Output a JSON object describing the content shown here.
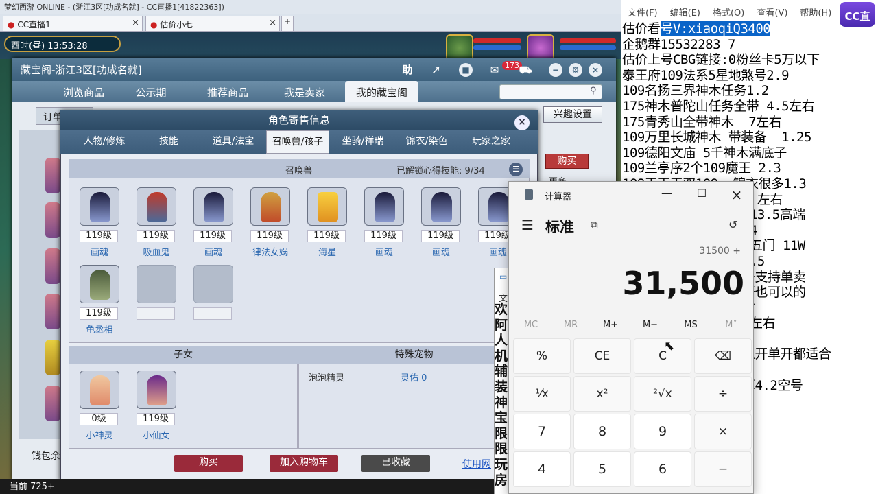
{
  "browser": {
    "title_text": "梦幻西游 ONLINE - (浙江3区[功成名就] - CC直播1[41822363])",
    "tabs": [
      {
        "label": "CC直播1"
      },
      {
        "label": "估价小七"
      }
    ],
    "new_tab_label": "+"
  },
  "game": {
    "clock": "酉时(昼)   13:53:28",
    "bottom_bar": "当前   725+"
  },
  "zbg": {
    "title": "藏宝阁-浙江3区[功成名就]",
    "header_icons": {
      "help": "助",
      "badge": "173"
    },
    "nav": [
      {
        "label": "浏览商品"
      },
      {
        "label": "公示期"
      },
      {
        "label": "推荐商品"
      },
      {
        "label": "我是卖家"
      },
      {
        "label": "我的藏宝阁"
      }
    ],
    "order_tab": "订单",
    "interest_btn": "兴趣设置",
    "buy_btn": "购买",
    "more": "更多",
    "wallet": "钱包余"
  },
  "dialog": {
    "title": "角色寄售信息",
    "tabs": [
      {
        "label": "人物/修炼"
      },
      {
        "label": "技能"
      },
      {
        "label": "道具/法宝"
      },
      {
        "label": "召唤兽/孩子"
      },
      {
        "label": "坐骑/祥瑞"
      },
      {
        "label": "锦衣/染色"
      },
      {
        "label": "玩家之家"
      }
    ],
    "summon": {
      "title": "召唤兽",
      "unlock_label": "已解锁心得技能:",
      "unlock_value": "9/34",
      "pets": [
        {
          "level": "119级",
          "name": "画魂"
        },
        {
          "level": "119级",
          "name": "吸血鬼"
        },
        {
          "level": "119级",
          "name": "画魂"
        },
        {
          "level": "119级",
          "name": "律法女娲"
        },
        {
          "level": "119级",
          "name": "海星"
        },
        {
          "level": "119级",
          "name": "画魂"
        },
        {
          "level": "119级",
          "name": "画魂"
        },
        {
          "level": "119级",
          "name": "画魂"
        },
        {
          "level": "119级",
          "name": "龟丞相"
        }
      ]
    },
    "kids": {
      "title": "子女",
      "items": [
        {
          "level": "0级",
          "name": "小神灵"
        },
        {
          "level": "119级",
          "name": "小仙女"
        }
      ]
    },
    "special": {
      "title": "特殊宠物",
      "name": "泡泡精灵",
      "value": "灵佑 0"
    },
    "buttons": {
      "buy": "购买",
      "cart": "加入购物车",
      "collected": "已收藏",
      "use_link": "使用网"
    }
  },
  "notepad": {
    "menu": [
      "文件(F)",
      "编辑(E)",
      "格式(O)",
      "查看(V)",
      "帮助(H)"
    ],
    "line1_prefix": "估价看",
    "line1_highlight": "号V:xiaoqiQ3400",
    "lines": [
      "企鹅群15532283 7",
      "估价上号CBG链接:0粉丝卡5万以下",
      "泰王府109法系5星地煞号2.9",
      "109名扬三界神木任务1.2",
      "175神木普陀山任务全带 4.5左右",
      "175青秀山全带神木  7左右",
      "109万里长城神木 带装备  1.25",
      "109德阳文庙 5千神木满底子",
      "109兰亭序2个109魔王 2.3",
      "109王王王双109  锦衣很多1.3",
      "                  左右",
      "                 13.5高端",
      "                 4",
      "                9五门 11W",
      "                 .5",
      "                号支持单卖",
      "                开也可以的",
      "                右",
      "                3左右",
      "",
      "                五开单开都适合",
      "",
      "                算4.2空号"
    ],
    "cc_logo": "CC直播"
  },
  "partial_window": {
    "top_label": "文",
    "chars": "欢\n阿\n人\n机\n辅\n装\n神\n宝\n限\n限\n玩\n房"
  },
  "calculator": {
    "title": "计算器",
    "mode": "标准",
    "expression": "31500 +",
    "display": "31,500",
    "memory": [
      {
        "label": "MC",
        "enabled": false
      },
      {
        "label": "MR",
        "enabled": false
      },
      {
        "label": "M+",
        "enabled": true
      },
      {
        "label": "M−",
        "enabled": true
      },
      {
        "label": "MS",
        "enabled": true
      },
      {
        "label": "M˅",
        "enabled": false
      }
    ],
    "keys": [
      {
        "label": "%"
      },
      {
        "label": "CE"
      },
      {
        "label": "C"
      },
      {
        "label": "⌫"
      },
      {
        "label": "¹⁄x"
      },
      {
        "label": "x²"
      },
      {
        "label": "²√x"
      },
      {
        "label": "÷"
      },
      {
        "label": "7"
      },
      {
        "label": "8"
      },
      {
        "label": "9"
      },
      {
        "label": "×"
      },
      {
        "label": "4"
      },
      {
        "label": "5"
      },
      {
        "label": "6"
      },
      {
        "label": "−"
      }
    ]
  }
}
